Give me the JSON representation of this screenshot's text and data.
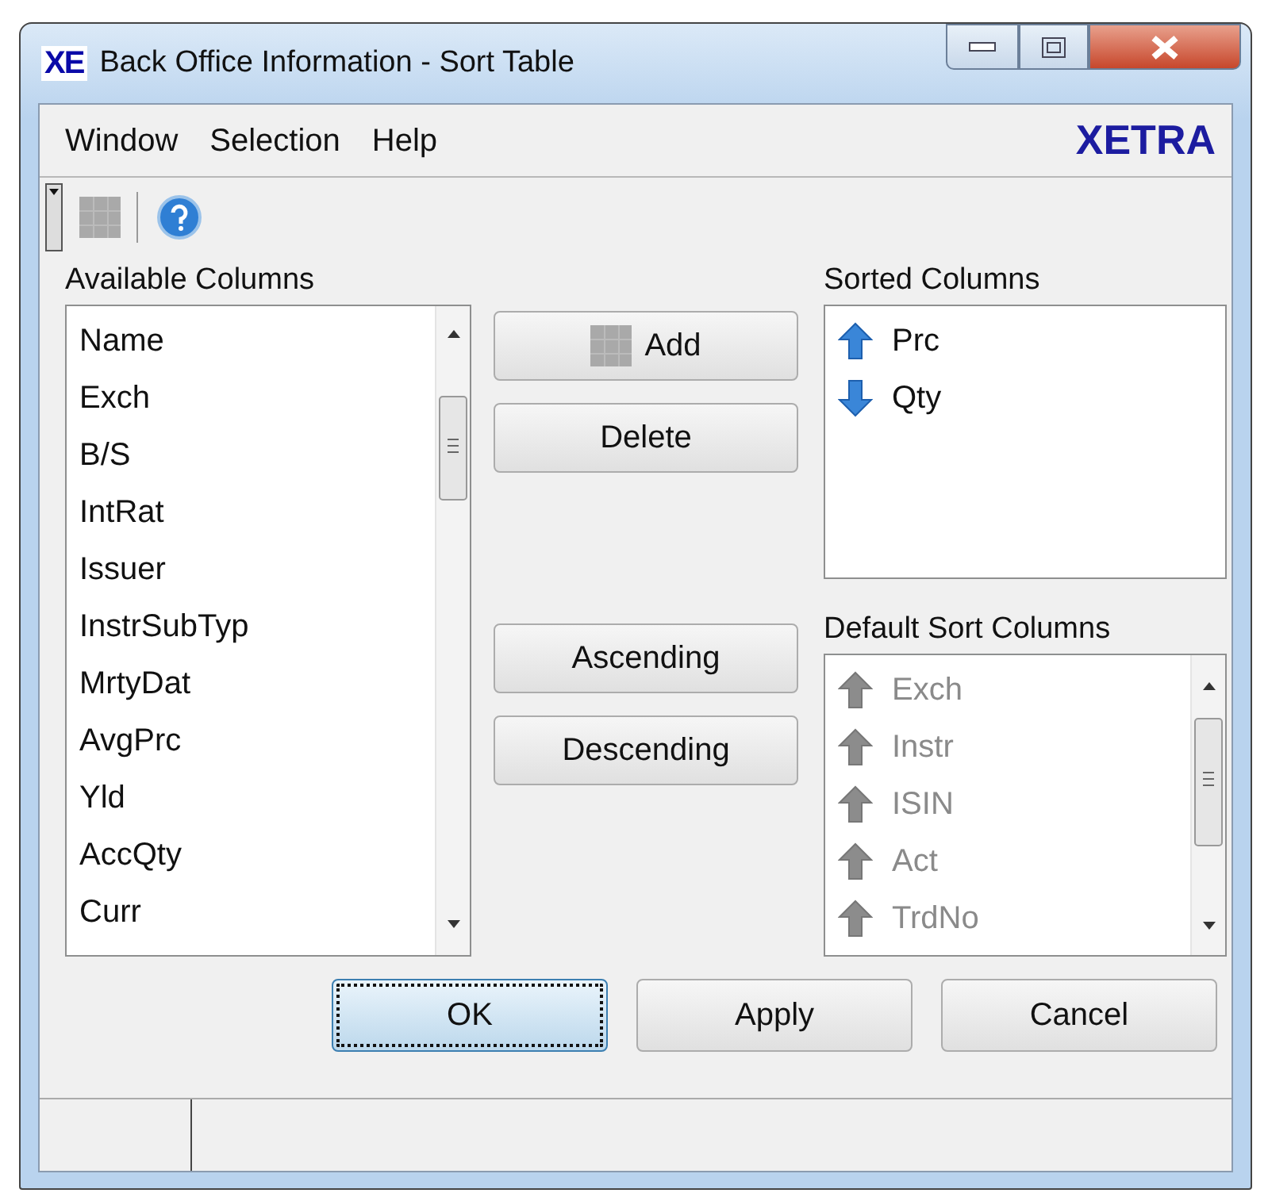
{
  "window": {
    "title": "Back Office Information - Sort Table",
    "logo": "XE"
  },
  "menu": [
    {
      "label": "Window"
    },
    {
      "label": "Selection"
    },
    {
      "label": "Help"
    }
  ],
  "brand": "XETRA",
  "available_columns": {
    "label": "Available Columns",
    "items": [
      {
        "label": "Name"
      },
      {
        "label": "Exch"
      },
      {
        "label": "B/S"
      },
      {
        "label": "IntRat"
      },
      {
        "label": "Issuer"
      },
      {
        "label": "InstrSubTyp"
      },
      {
        "label": "MrtyDat"
      },
      {
        "label": "AvgPrc"
      },
      {
        "label": "Yld"
      },
      {
        "label": "AccQty"
      },
      {
        "label": "Curr"
      }
    ]
  },
  "actions": [
    {
      "label": "Add",
      "kind": "icon"
    },
    {
      "label": "Delete",
      "kind": "plain"
    },
    {
      "label": "Ascending",
      "kind": "plain"
    },
    {
      "label": "Descending",
      "kind": "plain"
    }
  ],
  "sorted_columns": {
    "label": "Sorted Columns",
    "disabled": false,
    "items": [
      {
        "label": "Prc",
        "descending": false
      },
      {
        "label": "Qty",
        "descending": true
      }
    ]
  },
  "default_sort_columns": {
    "label": "Default Sort Columns",
    "disabled": true,
    "items": [
      {
        "label": "Exch",
        "descending": false
      },
      {
        "label": "Instr",
        "descending": false
      },
      {
        "label": "ISIN",
        "descending": false
      },
      {
        "label": "Act",
        "descending": false
      },
      {
        "label": "TrdNo",
        "descending": false
      }
    ]
  },
  "dialog_buttons": [
    {
      "label": "OK",
      "focused": true
    },
    {
      "label": "Apply",
      "focused": false
    },
    {
      "label": "Cancel",
      "focused": false
    }
  ]
}
